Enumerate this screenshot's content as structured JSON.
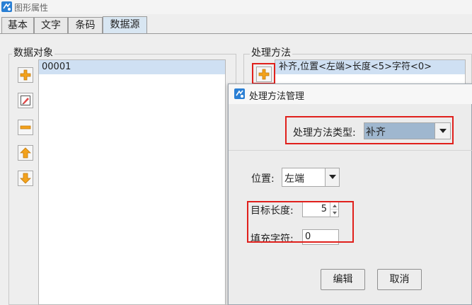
{
  "window": {
    "title": "图形属性"
  },
  "tabs": [
    {
      "label": "基本"
    },
    {
      "label": "文字"
    },
    {
      "label": "条码"
    },
    {
      "label": "数据源"
    }
  ],
  "data_objects": {
    "label": "数据对象",
    "items": [
      "00001"
    ],
    "selected_index": 0,
    "buttons": [
      "add-icon",
      "edit-icon",
      "remove-icon",
      "move-up-icon",
      "move-down-icon"
    ]
  },
  "methods": {
    "label": "处理方法",
    "items": [
      "补齐,位置<左端>长度<5>字符<0>"
    ],
    "add_button": "add-icon"
  },
  "dialog": {
    "title": "处理方法管理",
    "type_label": "处理方法类型:",
    "type_value": "补齐",
    "position_label": "位置:",
    "position_value": "左端",
    "length_label": "目标长度:",
    "length_value": "5",
    "fill_label": "填充字符:",
    "fill_value": "0",
    "edit_button": "编辑",
    "cancel_button": "取消"
  },
  "colors": {
    "highlight": "#e0201c",
    "selection": "#cfe0f3",
    "icon_orange": "#f3a21c"
  }
}
